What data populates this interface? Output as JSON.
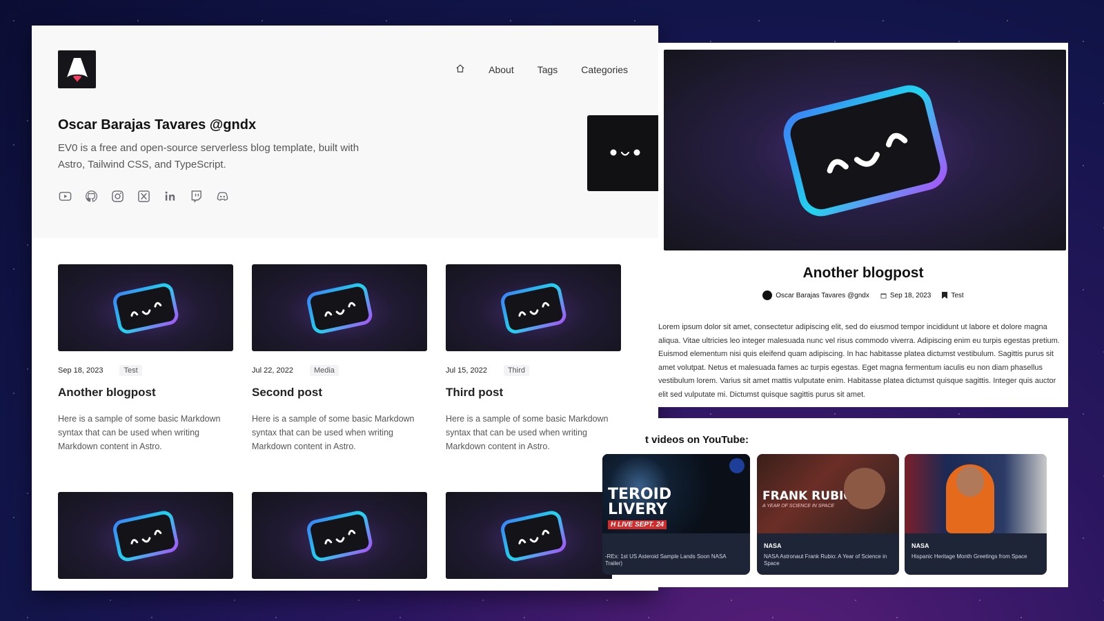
{
  "nav": {
    "home_icon": "home-icon",
    "links": [
      "About",
      "Tags",
      "Categories"
    ]
  },
  "profile": {
    "name": "Oscar Barajas Tavares @gndx",
    "bio": "EV0 is a free and open-source serverless blog template, built with Astro, Tailwind CSS, and TypeScript.",
    "socials": [
      "youtube-icon",
      "github-icon",
      "instagram-icon",
      "x-icon",
      "linkedin-icon",
      "twitch-icon",
      "discord-icon"
    ]
  },
  "posts": [
    {
      "date": "Sep 18, 2023",
      "tag": "Test",
      "title": "Another blogpost",
      "desc": "Here is a sample of some basic Markdown syntax that can be used when writing Markdown content in Astro."
    },
    {
      "date": "Jul 22, 2022",
      "tag": "Media",
      "title": "Second post",
      "desc": "Here is a sample of some basic Markdown syntax that can be used when writing Markdown content in Astro."
    },
    {
      "date": "Jul 15, 2022",
      "tag": "Third",
      "title": "Third post",
      "desc": "Here is a sample of some basic Markdown syntax that can be used when writing Markdown content in Astro."
    }
  ],
  "article": {
    "title": "Another blogpost",
    "author": "Oscar Barajas Tavares @gndx",
    "date": "Sep 18, 2023",
    "tag": "Test",
    "body": "Lorem ipsum dolor sit amet, consectetur adipiscing elit, sed do eiusmod tempor incididunt ut labore et dolore magna aliqua. Vitae ultricies leo integer malesuada nunc vel risus commodo viverra. Adipiscing enim eu turpis egestas pretium. Euismod elementum nisi quis eleifend quam adipiscing. In hac habitasse platea dictumst vestibulum. Sagittis purus sit amet volutpat. Netus et malesuada fames ac turpis egestas. Eget magna fermentum iaculis eu non diam phasellus vestibulum lorem. Varius sit amet mattis vulputate enim. Habitasse platea dictumst quisque sagittis. Integer quis auctor elit sed vulputate mi. Dictumst quisque sagittis purus sit amet."
  },
  "youtube": {
    "heading": "t videos on YouTube:",
    "videos": [
      {
        "overlay": "TEROID\nLIVERY",
        "overlay_sub": "H LIVE SEPT. 24",
        "channel": "",
        "title": "-REx: 1st US Asteroid Sample Lands Soon NASA Trailer)"
      },
      {
        "overlay": "FRANK RUBIO",
        "overlay_sub": "A YEAR OF SCIENCE IN SPACE",
        "channel": "NASA",
        "title": "NASA Astronaut Frank Rubio: A Year of Science in Space"
      },
      {
        "overlay": "",
        "overlay_sub": "",
        "channel": "NASA",
        "title": "Hispanic Heritage Month Greetings from Space"
      }
    ]
  },
  "colors": {
    "mascot_gradient_start": "#3b82f6",
    "mascot_gradient_mid": "#22d3ee",
    "mascot_gradient_end": "#a855f7",
    "logo_accent": "#f43f5e"
  }
}
